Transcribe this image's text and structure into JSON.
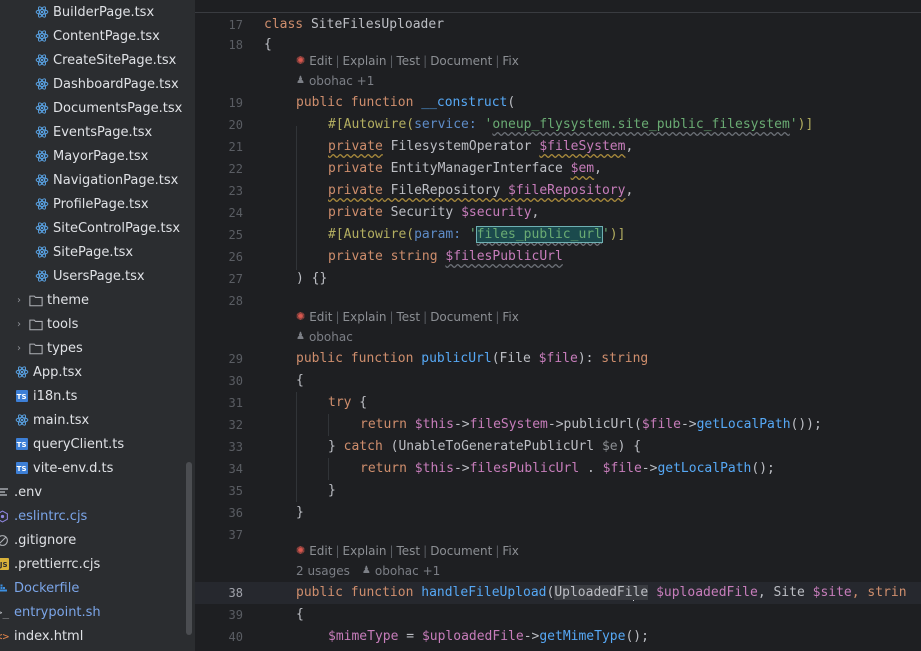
{
  "project_tree": {
    "items": [
      {
        "label": "BuilderPage.tsx",
        "icon": "react-icon",
        "indent": 2
      },
      {
        "label": "ContentPage.tsx",
        "icon": "react-icon",
        "indent": 2
      },
      {
        "label": "CreateSitePage.tsx",
        "icon": "react-icon",
        "indent": 2
      },
      {
        "label": "DashboardPage.tsx",
        "icon": "react-icon",
        "indent": 2
      },
      {
        "label": "DocumentsPage.tsx",
        "icon": "react-icon",
        "indent": 2
      },
      {
        "label": "EventsPage.tsx",
        "icon": "react-icon",
        "indent": 2
      },
      {
        "label": "MayorPage.tsx",
        "icon": "react-icon",
        "indent": 2
      },
      {
        "label": "NavigationPage.tsx",
        "icon": "react-icon",
        "indent": 2
      },
      {
        "label": "ProfilePage.tsx",
        "icon": "react-icon",
        "indent": 2
      },
      {
        "label": "SiteControlPage.tsx",
        "icon": "react-icon",
        "indent": 2
      },
      {
        "label": "SitePage.tsx",
        "icon": "react-icon",
        "indent": 2
      },
      {
        "label": "UsersPage.tsx",
        "icon": "react-icon",
        "indent": 2
      },
      {
        "label": "theme",
        "icon": "folder-icon",
        "indent": 1
      },
      {
        "label": "tools",
        "icon": "folder-icon",
        "indent": 1
      },
      {
        "label": "types",
        "icon": "folder-icon",
        "indent": 1
      },
      {
        "label": "App.tsx",
        "icon": "react-icon",
        "indent": 1
      },
      {
        "label": "i18n.ts",
        "icon": "ts-file-icon",
        "indent": 1
      },
      {
        "label": "main.tsx",
        "icon": "react-icon",
        "indent": 1
      },
      {
        "label": "queryClient.ts",
        "icon": "ts-file-icon",
        "indent": 1
      },
      {
        "label": "vite-env.d.ts",
        "icon": "ts-file-icon",
        "indent": 1
      },
      {
        "label": ".env",
        "icon": "env-file-icon",
        "indent": 0
      },
      {
        "label": ".eslintrc.cjs",
        "icon": "eslint-icon",
        "indent": 0
      },
      {
        "label": ".gitignore",
        "icon": "gitignore-icon",
        "indent": 0
      },
      {
        "label": ".prettierrc.cjs",
        "icon": "js-file-icon",
        "indent": 0
      },
      {
        "label": "Dockerfile",
        "icon": "docker-icon",
        "indent": 0
      },
      {
        "label": "entrypoint.sh",
        "icon": "shell-icon",
        "indent": 0
      },
      {
        "label": "index.html",
        "icon": "html-icon",
        "indent": 0
      }
    ]
  },
  "code_lens": {
    "edit": "Edit",
    "explain": "Explain",
    "test": "Test",
    "document": "Document",
    "fix": "Fix"
  },
  "meta": {
    "m1": "obohac +1",
    "m2": "obohac",
    "m3_usages": "2 usages",
    "m3_author": "obohac +1"
  },
  "line_numbers": {
    "l17": "17",
    "l18": "18",
    "l19": "19",
    "l20": "20",
    "l21": "21",
    "l22": "22",
    "l23": "23",
    "l24": "24",
    "l25": "25",
    "l26": "26",
    "l27": "27",
    "l28": "28",
    "l29": "29",
    "l30": "30",
    "l31": "31",
    "l32": "32",
    "l33": "33",
    "l34": "34",
    "l35": "35",
    "l36": "36",
    "l37": "37",
    "l38": "38",
    "l39": "39",
    "l40": "40"
  },
  "code": {
    "t_class": "class",
    "t_classname": " SiteFilesUploader",
    "t_brace_open": "{",
    "t_public": "public",
    "t_function": " function ",
    "t_construct": "__construct",
    "t_paren_open": "(",
    "t_attr1": "#[Autowire(",
    "t_service": "service:",
    "t_sp": " ",
    "t_q1": "'",
    "t_svcval": "oneup_flysystem.site_public_filesystem",
    "t_q2": "'",
    "t_attr1_end": ")]",
    "t_private": "private",
    "t_fso": " FilesystemOperator ",
    "t_fsvar": "$fileSystem",
    "t_comma": ",",
    "t_emi": " EntityManagerInterface ",
    "t_emvar": "$em",
    "t_frepo": " FileRepository ",
    "t_frepovar": "$fileRepository",
    "t_security": " Security ",
    "t_secvar": "$security",
    "t_attr2": "#[Autowire(",
    "t_param": "param:",
    "t_paramval": "files_public_url",
    "t_attr2_end": ")]",
    "t_string": " string ",
    "t_fpuvar": "$filesPublicUrl",
    "t_ctor_end": ") {}",
    "t_publicurl": "publicUrl",
    "t_pu_args1": "(File ",
    "t_filevar": "$file",
    "t_pu_args2": "): ",
    "t_ret_string": "string",
    "t_try": "try",
    "t_brace_sp": " {",
    "t_return": "return",
    "t_this": " $this",
    "t_arrow": "->",
    "t_fsprop": "fileSystem",
    "t_pubcall": "publicUrl",
    "t_open2": "(",
    "t_glp": "getLocalPath",
    "t_close3": "());",
    "t_close_brace": "}",
    "t_catch": " catch ",
    "t_catch_args": "(UnableToGeneratePublicUrl ",
    "t_evar": "$e",
    "t_catch_end": ") {",
    "t_fpuprop": "filesPublicUrl",
    "t_dot": " . ",
    "t_close2": "();",
    "t_handle": "handleFileUpload",
    "t_uf_a": "UploadedFi",
    "t_uf_b": "le",
    "t_ufvar": "$uploadedFile",
    "t_site": ", Site ",
    "t_sitevar": "$site",
    "t_strin": ", strin",
    "t_mimevar": "$mimeType",
    "t_assign": " = ",
    "t_ufvar2": "$uploadedFile",
    "t_getmime": "getMimeType",
    "t_semi": "();"
  }
}
